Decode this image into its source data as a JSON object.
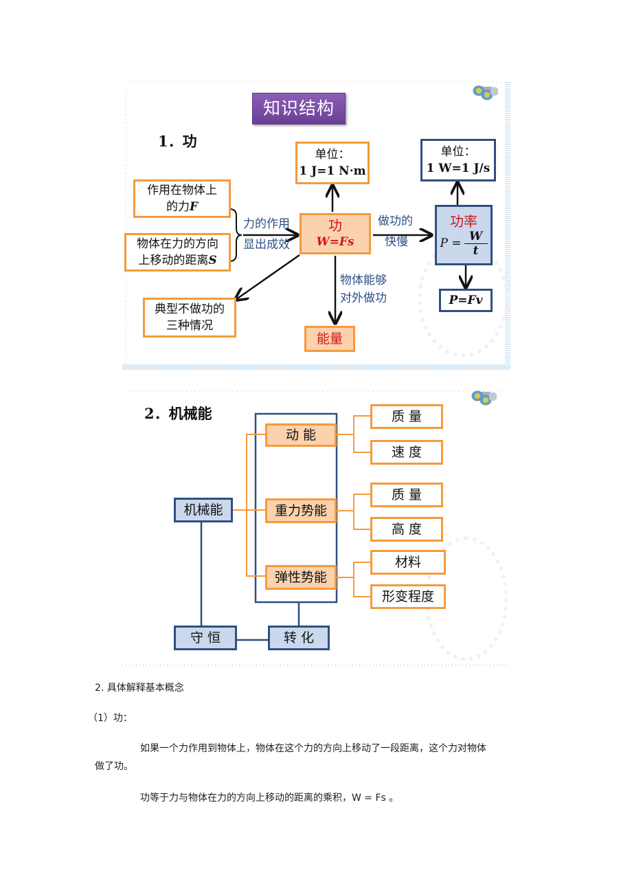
{
  "slide1": {
    "title": "知识结构",
    "heading": "1．功",
    "work_unit": {
      "label": "单位：",
      "value": "1 J=1 N·m"
    },
    "force_box": {
      "line1": "作用在物体上",
      "line2": "的力",
      "var": "F"
    },
    "distance_box": {
      "line1": "物体在力的方向",
      "line2": "上移动的距离",
      "var": "S"
    },
    "force_effect": {
      "line1": "力的作用",
      "line2": "显出成效"
    },
    "work_box": {
      "title": "功",
      "formula": "W=Fs"
    },
    "speed_label": {
      "line1": "做功的",
      "line2": "快慢"
    },
    "power_unit": {
      "label": "单位：",
      "value": "1 W=1 J/s"
    },
    "power_box": {
      "title": "功率",
      "lhs": "P =",
      "num": "W",
      "den": "t"
    },
    "power_formula": "P=Fv",
    "no_work_box": {
      "line1": "典型不做功的",
      "line2": "三种情况"
    },
    "energy_label": {
      "line1": "物体能够",
      "line2": "对外做功"
    },
    "energy_box": "能量",
    "icon": "binoculars-icon"
  },
  "slide2": {
    "heading": "2．机械能",
    "root": "机械能",
    "branches": [
      {
        "name": "动 能",
        "factors": [
          "质 量",
          "速 度"
        ]
      },
      {
        "name": "重力势能",
        "factors": [
          "质 量",
          "高 度"
        ]
      },
      {
        "name": "弹性势能",
        "factors": [
          "材料",
          "形变程度"
        ]
      }
    ],
    "conservation": "守 恒",
    "conversion": "转 化",
    "icon": "binoculars-icon"
  },
  "document": {
    "section_heading": "2.     具体解释基本概念",
    "subsection": "（1）功：",
    "paragraph1": "如果一个力作用到物体上，物体在这个力的方向上移动了一段距离，这个力对物体",
    "paragraph1_cont": "做了功。",
    "paragraph2": "功等于力与物体在力的方向上移动的距离的乘积，W = Fs  。"
  }
}
